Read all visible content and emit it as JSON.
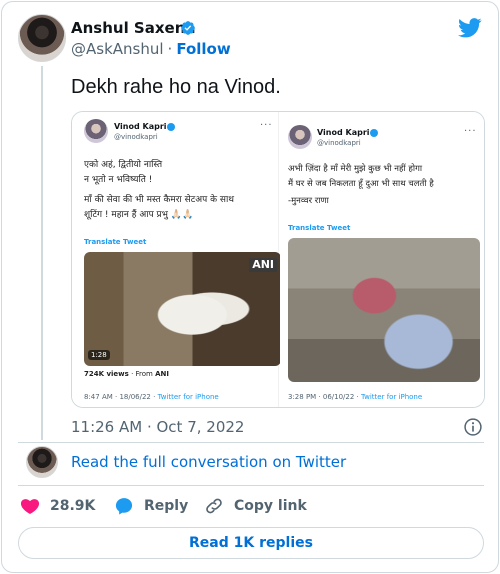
{
  "author": {
    "name": "Anshul Saxena",
    "handle": "@AskAnshul",
    "follow_label": "Follow",
    "separator": "·"
  },
  "tweet": {
    "text": "Dekh rahe ho na Vinod.",
    "timestamp": "11:26 AM · Oct 7, 2022"
  },
  "embedded_shots": [
    {
      "name": "Vinod Kapri",
      "handle": "@vinodkapri",
      "lines": [
        "एको अहं, द्वितीयो नास्ति",
        "न भूतो न भविष्यति !",
        "माँ की सेवा की भी मस्त कैमरा सेटअप के साथ",
        "शूटिंग ! महान हैं आप प्रभु 🙏🏻🙏🏻"
      ],
      "translate_label": "Translate Tweet",
      "video_badge": "ANI",
      "video_duration": "1:28",
      "views": "724K views",
      "views_from": "· From",
      "views_source": "ANI",
      "meta": "8:47 AM · 18/06/22 ·",
      "meta_client": "Twitter for iPhone"
    },
    {
      "name": "Vinod Kapri",
      "handle": "@vinodkapri",
      "lines": [
        "अभी ज़िंदा है माँ मेरी मुझे कुछ भी नहीं होगा",
        "मैं घर से जब निकलता हूँ दुआ भी साथ चलती है",
        "-मुनव्वर राणा"
      ],
      "translate_label": "Translate Tweet",
      "meta": "3:28 PM · 06/10/22 ·",
      "meta_client": "Twitter for iPhone"
    }
  ],
  "footer": {
    "read_conversation": "Read the full conversation on Twitter",
    "likes": "28.9K",
    "reply_label": "Reply",
    "copy_link_label": "Copy link",
    "read_replies": "Read 1K replies"
  },
  "colors": {
    "twitter_blue": "#1d9bf0",
    "link_blue": "#006fd6",
    "like_red": "#f91880",
    "muted": "#536471",
    "border": "#cfd9de"
  },
  "icons": [
    "verified-badge-icon",
    "twitter-bird-icon",
    "info-icon",
    "heart-icon",
    "reply-bubble-icon",
    "link-icon"
  ]
}
